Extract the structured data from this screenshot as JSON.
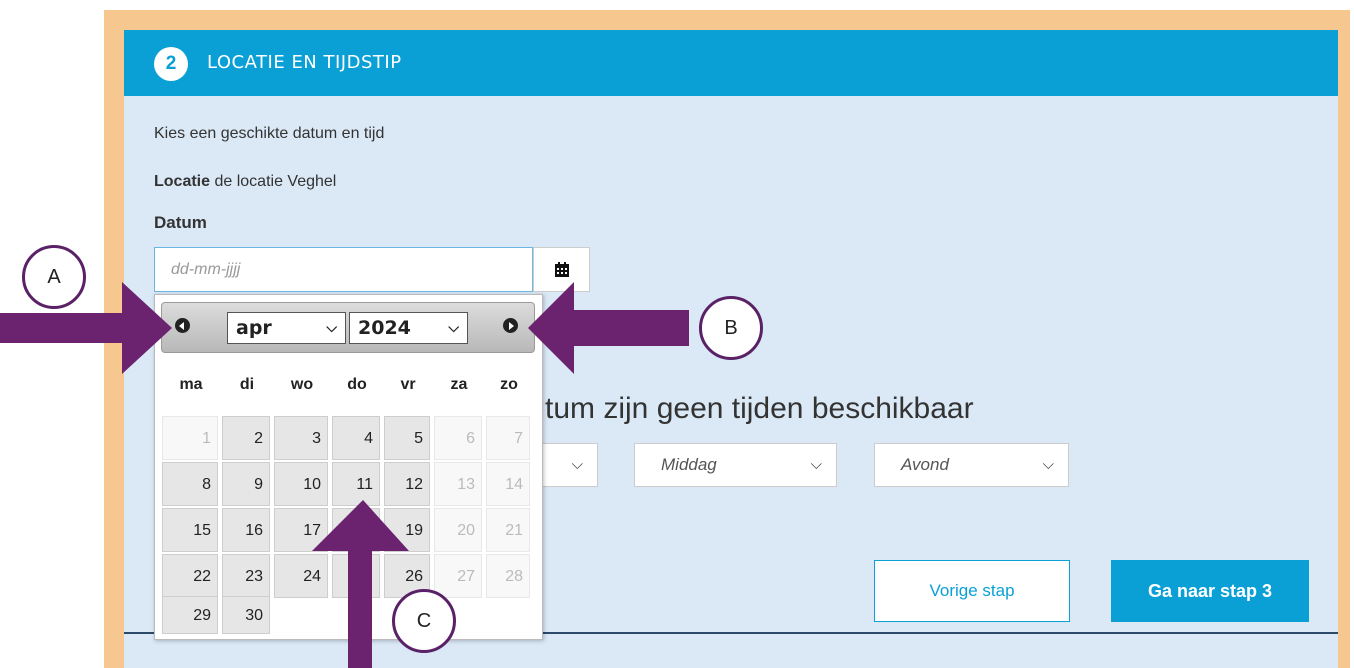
{
  "step": {
    "number": "2",
    "title": "LOCATIE EN TIJDSTIP"
  },
  "intro": "Kies een geschikte datum en tijd",
  "location": {
    "label": "Locatie",
    "value": "de locatie Veghel"
  },
  "date": {
    "label": "Datum",
    "placeholder": "dd-mm-jjjj",
    "calendar_icon": "calendar-icon"
  },
  "no_times_text": "tum zijn geen tijden beschikbaar",
  "time_selects": {
    "middag": "Middag",
    "avond": "Avond"
  },
  "buttons": {
    "prev": "Vorige stap",
    "next": "Ga naar stap 3"
  },
  "datepicker": {
    "month": "apr",
    "year": "2024",
    "weekdays": [
      "ma",
      "di",
      "wo",
      "do",
      "vr",
      "za",
      "zo"
    ],
    "weeks": [
      [
        "1",
        "2",
        "3",
        "4",
        "5",
        "6",
        "7"
      ],
      [
        "8",
        "9",
        "10",
        "11",
        "12",
        "13",
        "14"
      ],
      [
        "15",
        "16",
        "17",
        "",
        "19",
        "20",
        "21"
      ],
      [
        "22",
        "23",
        "24",
        "",
        "26",
        "27",
        "28"
      ],
      [
        "29",
        "30",
        "",
        "",
        "",
        "",
        ""
      ]
    ]
  },
  "annotations": {
    "a": "A",
    "b": "B",
    "c": "C"
  },
  "colors": {
    "header": "#0aa0d6",
    "panel": "#dbe9f7",
    "frame": "#f6c890",
    "arrow": "#6b226f"
  }
}
